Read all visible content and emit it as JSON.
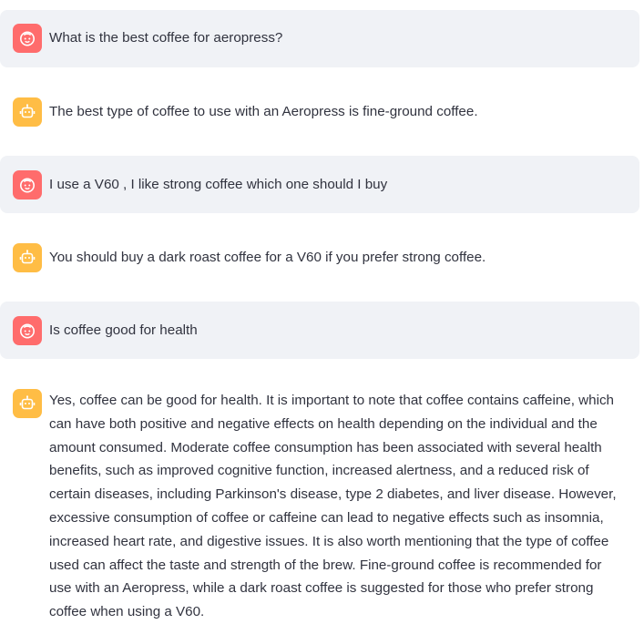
{
  "messages": [
    {
      "role": "user",
      "avatar_icon": "user-face-icon",
      "text": "What is the best coffee for aeropress?"
    },
    {
      "role": "assistant",
      "avatar_icon": "bot-icon",
      "text": "The best type of coffee to use with an Aeropress is fine-ground coffee."
    },
    {
      "role": "user",
      "avatar_icon": "user-face-icon",
      "text": "I use a V60 , I like strong coffee which one should I buy"
    },
    {
      "role": "assistant",
      "avatar_icon": "bot-icon",
      "text": "You should buy a dark roast coffee for a V60 if you prefer strong coffee."
    },
    {
      "role": "user",
      "avatar_icon": "user-face-icon",
      "text": "Is coffee good for health"
    },
    {
      "role": "assistant",
      "avatar_icon": "bot-icon",
      "text": "Yes, coffee can be good for health. It is important to note that coffee contains caffeine, which can have both positive and negative effects on health depending on the individual and the amount consumed. Moderate coffee consumption has been associated with several health benefits, such as improved cognitive function, increased alertness, and a reduced risk of certain diseases, including Parkinson's disease, type 2 diabetes, and liver disease. However, excessive consumption of coffee or caffeine can lead to negative effects such as insomnia, increased heart rate, and digestive issues. It is also worth mentioning that the type of coffee used can affect the taste and strength of the brew. Fine-ground coffee is recommended for use with an Aeropress, while a dark roast coffee is suggested for those who prefer strong coffee when using a V60."
    }
  ],
  "colors": {
    "user_bg": "#f0f2f6",
    "user_avatar": "#ff6c6c",
    "assistant_avatar": "#ffbd45",
    "text": "#31333f"
  }
}
